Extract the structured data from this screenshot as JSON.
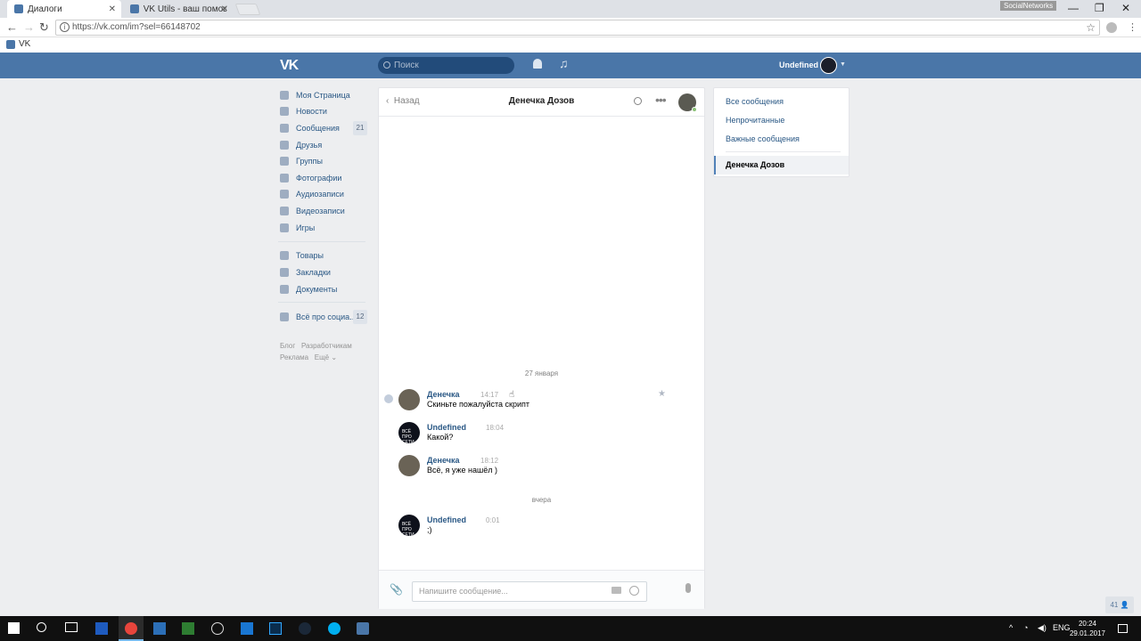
{
  "browser": {
    "tabs": [
      {
        "label": "Диалоги",
        "active": true
      },
      {
        "label": "VK Utils - ваш помощни",
        "active": false
      }
    ],
    "badge": "SocialNetworks",
    "url": "https://vk.com/im?sel=66148702",
    "bookmarks": [
      {
        "label": "VK"
      }
    ]
  },
  "header": {
    "logo": "VK",
    "search_placeholder": "Поиск",
    "user_name": "Undefined"
  },
  "leftnav": {
    "items": [
      {
        "label": "Моя Страница",
        "count": ""
      },
      {
        "label": "Новости",
        "count": ""
      },
      {
        "label": "Сообщения",
        "count": "21"
      },
      {
        "label": "Друзья",
        "count": ""
      },
      {
        "label": "Группы",
        "count": ""
      },
      {
        "label": "Фотографии",
        "count": ""
      },
      {
        "label": "Аудиозаписи",
        "count": ""
      },
      {
        "label": "Видеозаписи",
        "count": ""
      },
      {
        "label": "Игры",
        "count": ""
      },
      {
        "label": "Товары",
        "count": ""
      },
      {
        "label": "Закладки",
        "count": ""
      },
      {
        "label": "Документы",
        "count": ""
      },
      {
        "label": "Всё про социа...",
        "count": "12"
      }
    ],
    "footer": [
      "Блог",
      "Разработчикам",
      "Реклама",
      "Ещё"
    ]
  },
  "chat": {
    "back_label": "Назад",
    "title": "Денечка Дозов",
    "dates": [
      "27 января",
      "вчера"
    ],
    "messages": [
      {
        "author": "Денечка",
        "time": "14:17",
        "text": "Скиньте пожалуйста скрипт"
      },
      {
        "author": "Undefined",
        "time": "18:04",
        "text": "Какой?"
      },
      {
        "author": "Денечка",
        "time": "18:12",
        "text": "Всё, я уже нашёл )"
      },
      {
        "author": "Undefined",
        "time": "0:01",
        "text": ";)"
      }
    ],
    "avatar_caption": "ВСЁ ПРО СЕТИ",
    "input_placeholder": "Напишите сообщение..."
  },
  "right_panel": {
    "items": [
      "Все сообщения",
      "Непрочитанные",
      "Важные сообщения"
    ],
    "active": "Денечка Дозов"
  },
  "online_count": "41",
  "taskbar": {
    "lang": "ENG",
    "time": "20:24",
    "date": "29.01.2017"
  }
}
